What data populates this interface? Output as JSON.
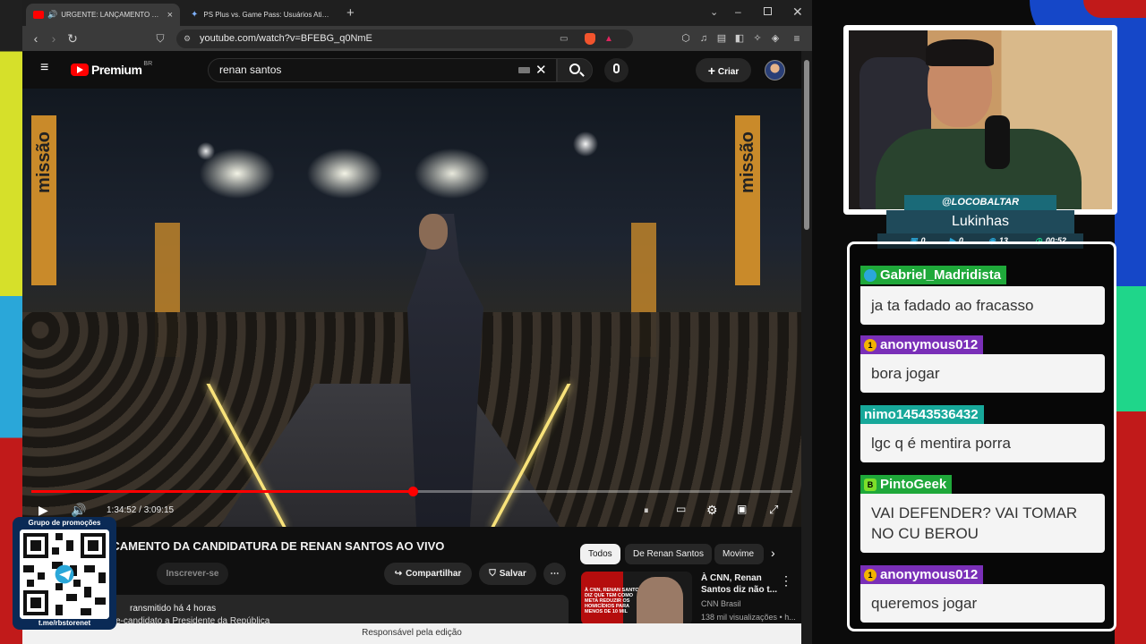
{
  "browser": {
    "tabs": [
      {
        "label": "URGENTE: LANÇAMENTO DA CANI",
        "active": true
      },
      {
        "label": "PS Plus vs. Game Pass: Usuários Ativos - Goo",
        "active": false
      }
    ],
    "url": "youtube.com/watch?v=BFEBG_q0NmE"
  },
  "youtube": {
    "logo_text": "Premium",
    "logo_region": "BR",
    "search_value": "renan santos",
    "create_label": "Criar"
  },
  "player": {
    "time": "1:34:52 / 3:09:15",
    "progress": 0.501,
    "banner_text": "missão"
  },
  "video": {
    "title": "NCAMENTO DA CANDIDATURA DE RENAN SANTOS AO VIVO",
    "subscribe_label": "Inscrever-se",
    "share_label": "Compartilhar",
    "save_label": "Salvar",
    "desc_line1": "ransmitido há 4 horas",
    "desc_line2": "e-candidato a Presidente da República"
  },
  "recommendations": {
    "chips": [
      "Todos",
      "De Renan Santos",
      "Movime"
    ],
    "item": {
      "title": "À CNN, Renan Santos diz não t...",
      "channel": "CNN Brasil",
      "views": "138 mil visualizações • h...",
      "thumb_text": "À CNN, RENAN SANTOS DIZ QUE TEM COMO META REDUZIR OS HOMICÍDIOS PARA MENOS DE 10 MIL"
    }
  },
  "footer_text": "Responsável pela edição",
  "promo": {
    "title": "Grupo de promoções",
    "link": "t.me/rbstorenet"
  },
  "streamer": {
    "handle": "@LOCOBALTAR",
    "name": "Lukinhas",
    "stats": [
      "0",
      "0",
      "13",
      "00:52"
    ]
  },
  "chat": [
    {
      "user": "Gabriel_Madridista",
      "color": "#1fa83a",
      "badge_color": "#2aa7d9",
      "text": "ja ta fadado ao fracasso"
    },
    {
      "user": "anonymous012",
      "color": "#7a2fb8",
      "badge_color": "#f2b300",
      "text": "bora jogar"
    },
    {
      "user": "nimo14543536432",
      "color": "#17a89a",
      "badge_color": "",
      "text": "lgc q é mentira porra"
    },
    {
      "user": "PintoGeek",
      "color": "#1fa83a",
      "badge_color": "#7ddf2a",
      "text": "VAI DEFENDER? VAI TOMAR NO CU BEROU"
    },
    {
      "user": "anonymous012",
      "color": "#7a2fb8",
      "badge_color": "#f2b300",
      "text": "queremos jogar"
    }
  ]
}
